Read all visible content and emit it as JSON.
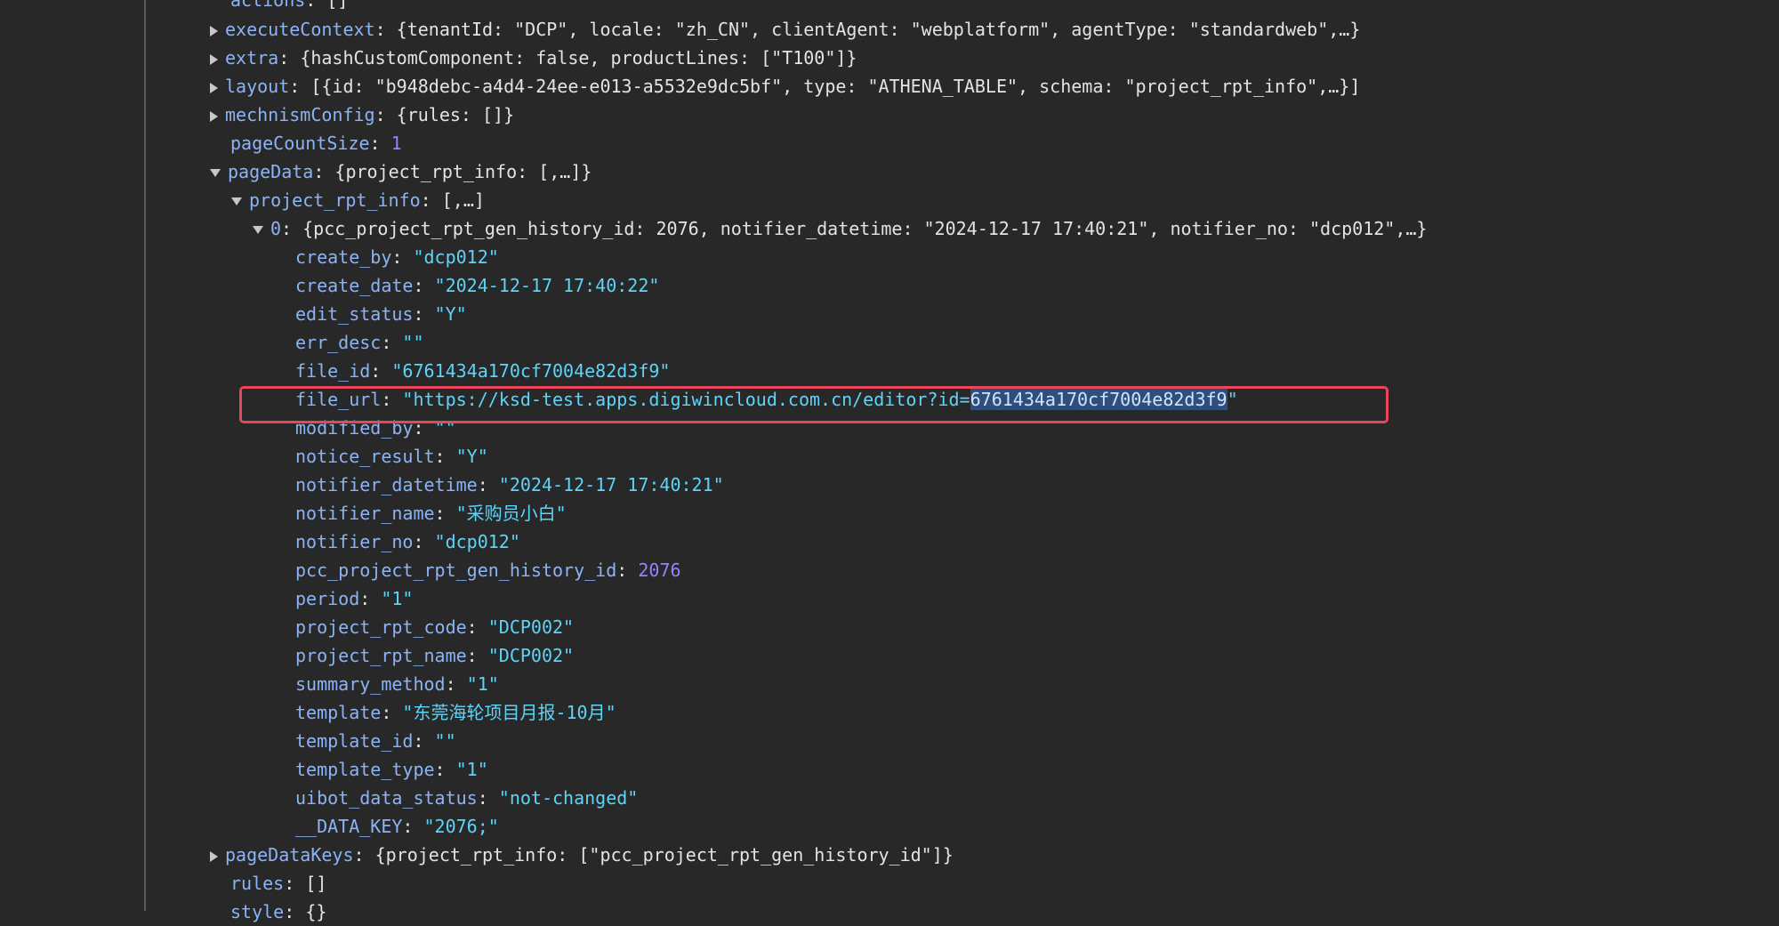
{
  "tree": {
    "actions": {
      "key": "actions",
      "value": "[]"
    },
    "executeContext": {
      "key": "executeContext",
      "preview": "{tenantId: \"DCP\", locale: \"zh_CN\", clientAgent: \"webplatform\", agentType: \"standardweb\",…}"
    },
    "extra": {
      "key": "extra",
      "preview": "{hashCustomComponent: false, productLines: [\"T100\"]}"
    },
    "layout": {
      "key": "layout",
      "preview": "[{id: \"b948debc-a4d4-24ee-e013-a5532e9dc5bf\", type: \"ATHENA_TABLE\", schema: \"project_rpt_info\",…}]"
    },
    "mechnismConfig": {
      "key": "mechnismConfig",
      "preview": "{rules: []}"
    },
    "pageCountSize": {
      "key": "pageCountSize",
      "value": "1"
    },
    "pageData": {
      "key": "pageData",
      "preview": "{project_rpt_info: [,…]}"
    },
    "project_rpt_info": {
      "key": "project_rpt_info",
      "preview": "[,…]"
    },
    "item0": {
      "key": "0",
      "preview": "{pcc_project_rpt_gen_history_id: 2076, notifier_datetime: \"2024-12-17 17:40:21\", notifier_no: \"dcp012\",…}"
    },
    "fields": [
      {
        "key": "create_by",
        "value": "\"dcp012\""
      },
      {
        "key": "create_date",
        "value": "\"2024-12-17 17:40:22\""
      },
      {
        "key": "edit_status",
        "value": "\"Y\""
      },
      {
        "key": "err_desc",
        "value": "\"\""
      },
      {
        "key": "file_id",
        "value": "\"6761434a170cf7004e82d3f9\""
      },
      {
        "key": "file_url",
        "value_before": "\"https://ksd-test.apps.digiwincloud.com.cn/editor?id=",
        "value_selected": "6761434a170cf7004e82d3f9",
        "value_after": "\""
      },
      {
        "key": "modified_by",
        "value": "\"\""
      },
      {
        "key": "notice_result",
        "value": "\"Y\""
      },
      {
        "key": "notifier_datetime",
        "value": "\"2024-12-17 17:40:21\""
      },
      {
        "key": "notifier_name",
        "value": "\"采购员小白\""
      },
      {
        "key": "notifier_no",
        "value": "\"dcp012\""
      },
      {
        "key": "pcc_project_rpt_gen_history_id",
        "value": "2076"
      },
      {
        "key": "period",
        "value": "\"1\""
      },
      {
        "key": "project_rpt_code",
        "value": "\"DCP002\""
      },
      {
        "key": "project_rpt_name",
        "value": "\"DCP002\""
      },
      {
        "key": "summary_method",
        "value": "\"1\""
      },
      {
        "key": "template",
        "value": "\"东莞海轮项目月报-10月\""
      },
      {
        "key": "template_id",
        "value": "\"\""
      },
      {
        "key": "template_type",
        "value": "\"1\""
      },
      {
        "key": "uibot_data_status",
        "value": "\"not-changed\""
      },
      {
        "key": "__DATA_KEY",
        "value": "\"2076;\""
      }
    ],
    "pageDataKeys": {
      "key": "pageDataKeys",
      "preview": "{project_rpt_info: [\"pcc_project_rpt_gen_history_id\"]}"
    },
    "rules": {
      "key": "rules",
      "value": "[]"
    },
    "style": {
      "key": "style",
      "value": "{}"
    }
  },
  "colors": {
    "background": "#282828",
    "key": "#8ab4f8",
    "string": "#5cd5fb",
    "number": "#9980ff",
    "highlight": "#e8465a",
    "selection": "#2f4e7c"
  }
}
